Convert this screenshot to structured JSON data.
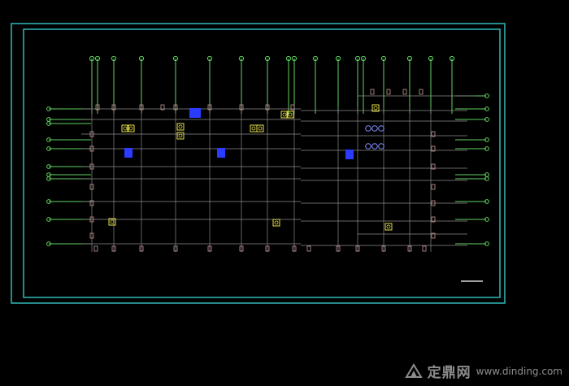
{
  "canvas": {
    "background": "#000000",
    "frame_color": "#35c6c6",
    "axis_color": "#5fd35f",
    "grid_color": "#8a8a8a",
    "column_color": "#c89a9a",
    "yellow_symbol": "#e8e04a",
    "blue_symbol": "#2a3cff"
  },
  "watermark": {
    "logo_icon": "leaf-logo-icon",
    "text": "zhulong-style watermark",
    "brand": "定鼎网",
    "url": "www.dinding.com"
  }
}
